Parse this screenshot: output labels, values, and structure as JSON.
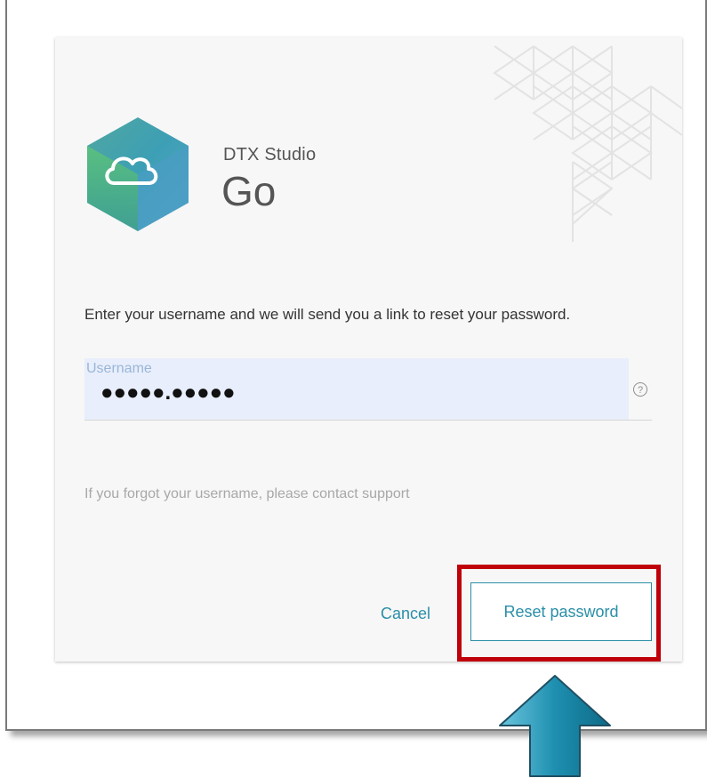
{
  "app": {
    "brand_line1": "DTX Studio",
    "brand_line2": "Go"
  },
  "form": {
    "instruction": "Enter your username and we will send you a link to reset your password.",
    "username_label": "Username",
    "username_value": "●●●●●.●●●●●",
    "help_icon_glyph": "?",
    "support_note": "If you forgot your username, please contact support"
  },
  "actions": {
    "cancel_label": "Cancel",
    "reset_label": "Reset password"
  },
  "colors": {
    "accent": "#2a8fa8",
    "highlight": "#c0000a",
    "field_bg": "#e8eefb",
    "arrow": "#1e8fb0"
  },
  "icons": {
    "logo": "cloud-hexagon-icon",
    "help": "question-circle-icon",
    "pointer": "up-arrow-icon"
  }
}
